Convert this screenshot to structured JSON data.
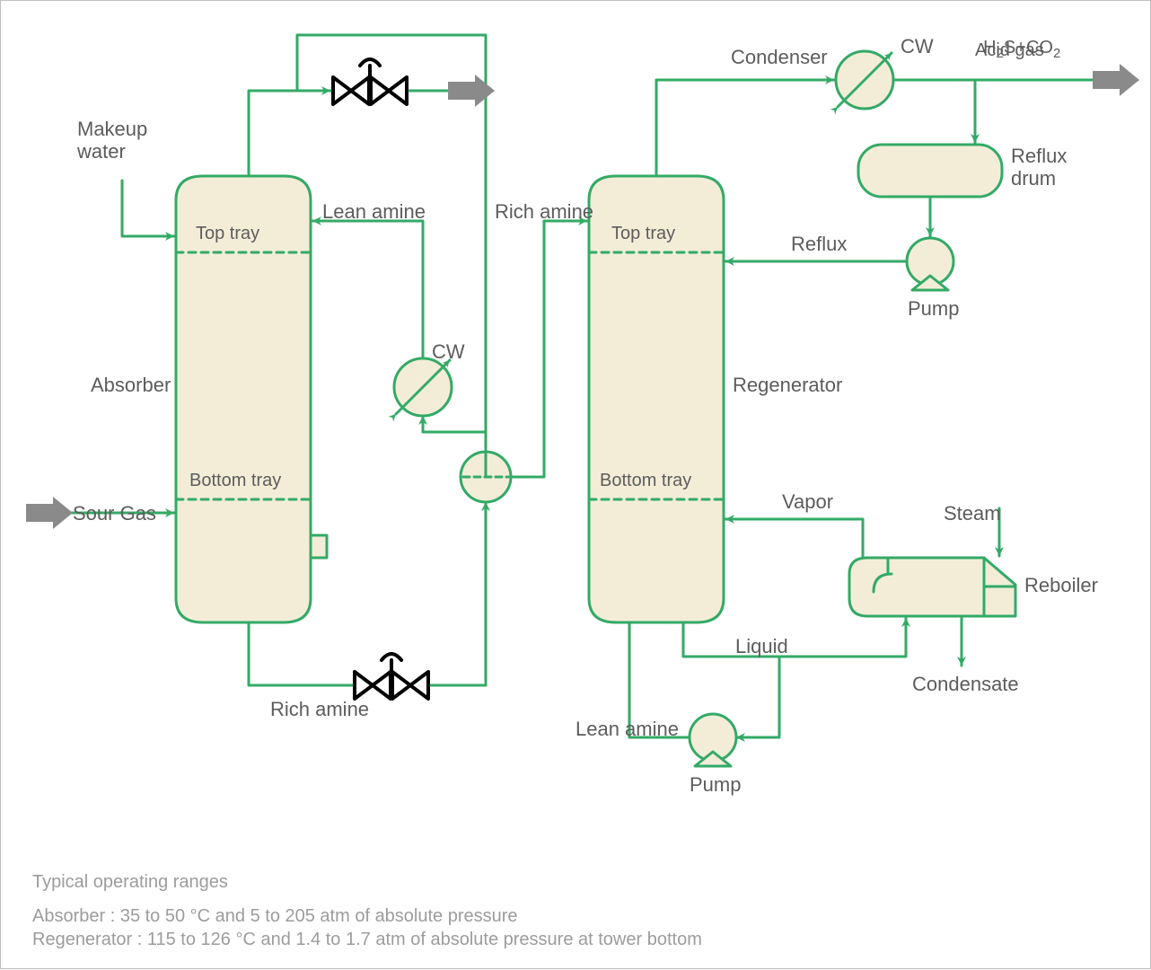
{
  "labels": {
    "makeup_water": "Makeup\nwater",
    "absorber": "Absorber",
    "sour_gas": "Sour Gas",
    "top_tray_abs": "Top tray",
    "bottom_tray_abs": "Bottom tray",
    "lean_amine_top": "Lean amine",
    "rich_amine_bot": "Rich amine",
    "rich_amine_mid": "Rich amine",
    "cw_abs": "CW",
    "regenerator": "Regenerator",
    "top_tray_reg": "Top tray",
    "bottom_tray_reg": "Bottom tray",
    "condenser": "Condenser",
    "cw_cond": "CW",
    "acid_gas_line1": "H",
    "acid_gas_line1_sub": "2",
    "acid_gas_line1_rest": "S+CO",
    "acid_gas_line1_sub2": "2",
    "acid_gas_line2": "Acid gas",
    "reflux_drum": "Reflux\ndrum",
    "reflux": "Reflux",
    "pump_reflux": "Pump",
    "vapor": "Vapor",
    "steam": "Steam",
    "reboiler": "Reboiler",
    "liquid": "Liquid",
    "condensate": "Condensate",
    "lean_amine_bot": "Lean amine",
    "pump_lean": "Pump",
    "footer_title": "Typical operating ranges",
    "footer_line1": "Absorber : 35 to 50 °C and 5 to 205 atm of absolute pressure",
    "footer_line2": "Regenerator : 115 to 126 °C and 1.4 to 1.7 atm of absolute pressure at tower bottom"
  },
  "colors": {
    "stroke": "#33aa66",
    "fill": "#f3edd8",
    "arrow_grey": "#8a8a8a",
    "text": "#5c5c5c",
    "black": "#000000"
  }
}
